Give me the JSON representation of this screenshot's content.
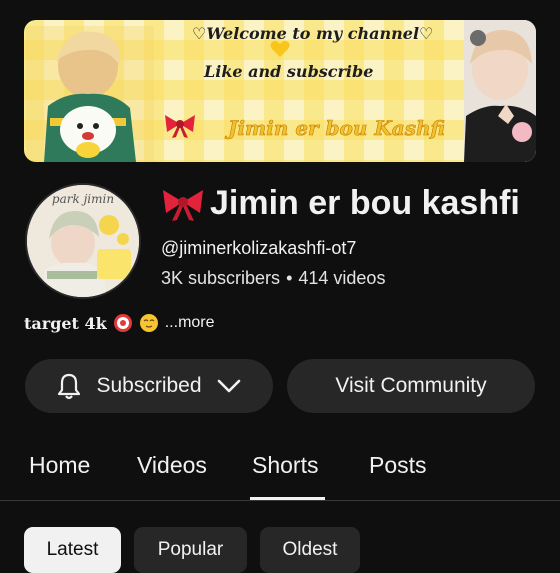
{
  "banner": {
    "line1": "♡Welcome to my channel♡",
    "line2": "Like and subscribe",
    "line3": "Jimin er bou Kashfi"
  },
  "avatar": {
    "label": "park jimin"
  },
  "channel": {
    "name": "Jimin er bou kashfi",
    "handle": "@jiminerkolizakashfi-ot7",
    "subscribers": "3K subscribers",
    "separator": "•",
    "videos": "414 videos"
  },
  "description": {
    "text": "target 4k",
    "more": "...more"
  },
  "buttons": {
    "subscribed": "Subscribed",
    "visit_community": "Visit Community"
  },
  "tabs": [
    {
      "label": "Home"
    },
    {
      "label": "Videos"
    },
    {
      "label": "Shorts",
      "selected": true
    },
    {
      "label": "Posts"
    }
  ],
  "chips": [
    {
      "label": "Latest",
      "selected": true
    },
    {
      "label": "Popular"
    },
    {
      "label": "Oldest"
    }
  ],
  "icons": {
    "bell": "bell-icon",
    "chevron": "chevron-down-icon",
    "bow": "ribbon-bow-icon",
    "target": "target-emoji",
    "relieved": "relieved-face-emoji"
  },
  "colors": {
    "background": "#0f0f0f",
    "button_bg": "#272727",
    "text": "#f1f1f1",
    "bow_red": "#e2233b",
    "banner_yellow": "#fade60"
  }
}
